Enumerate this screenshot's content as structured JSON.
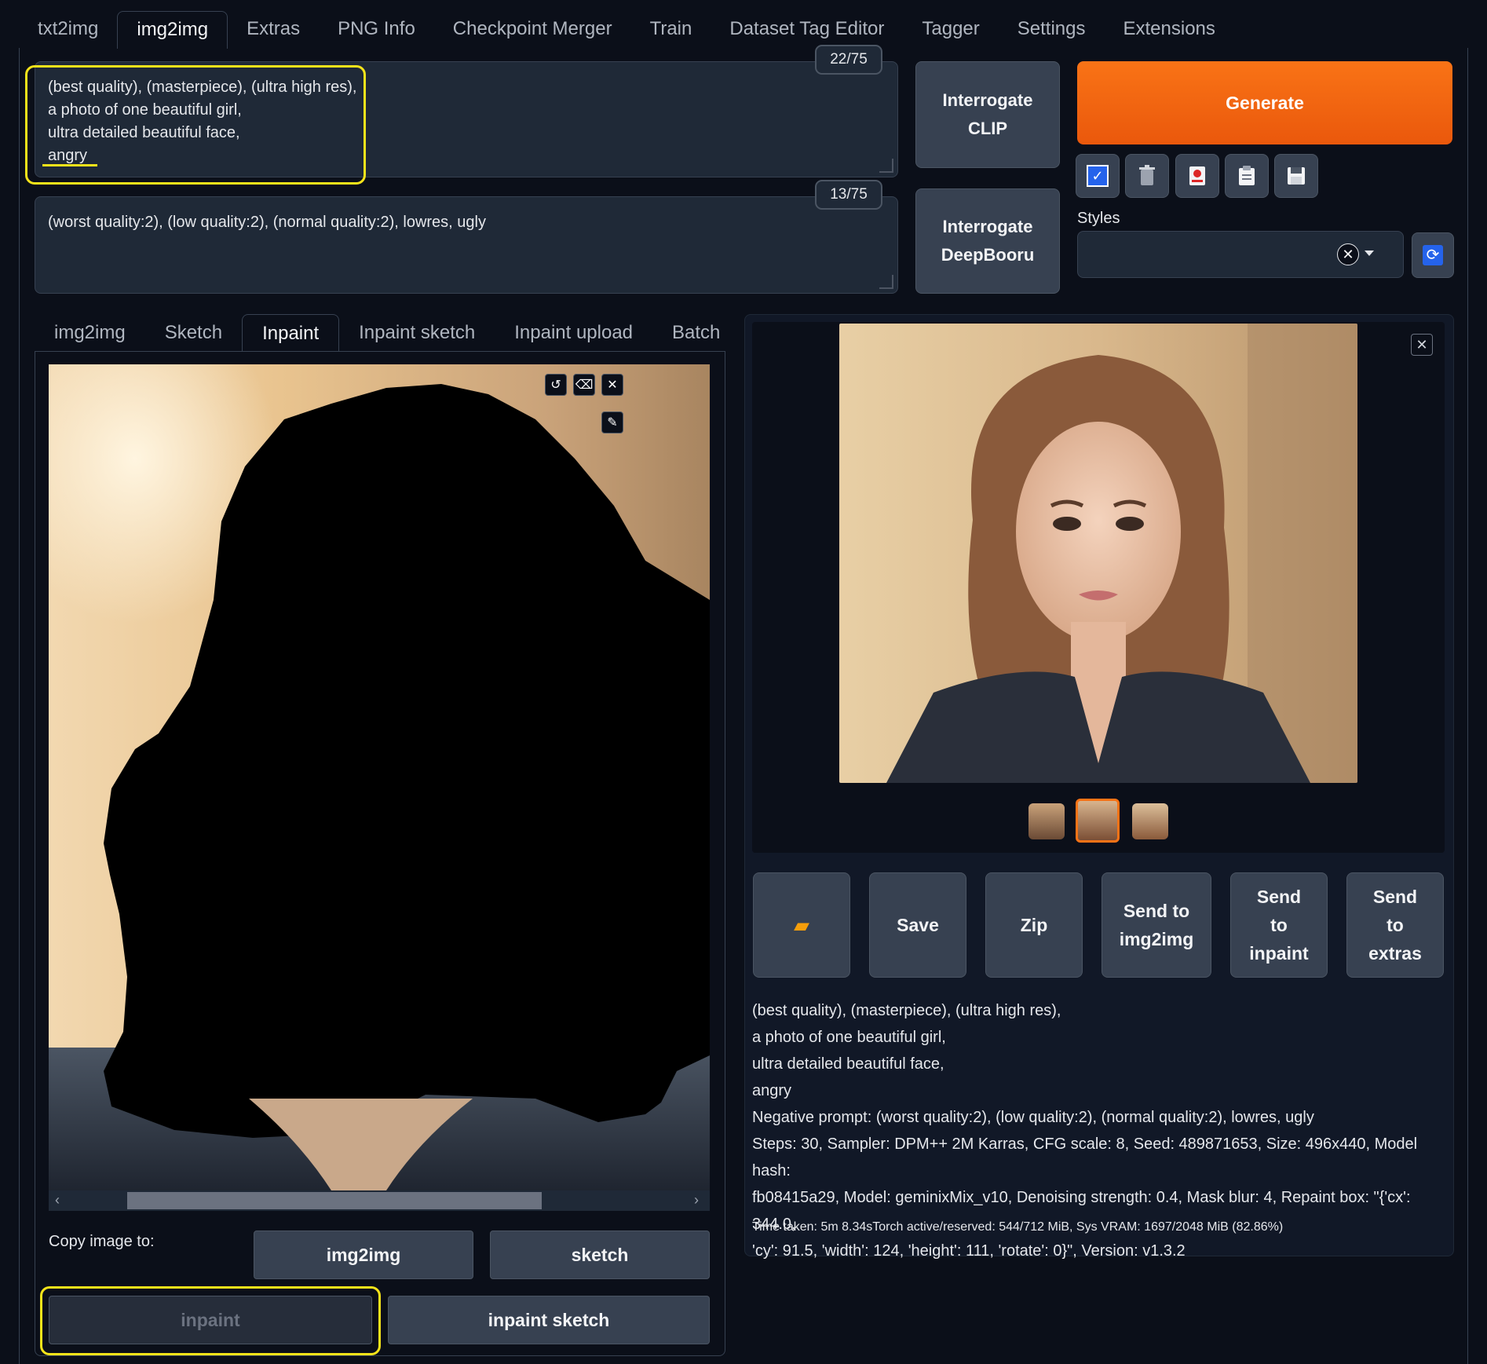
{
  "top_tabs": [
    "txt2img",
    "img2img",
    "Extras",
    "PNG Info",
    "Checkpoint Merger",
    "Train",
    "Dataset Tag Editor",
    "Tagger",
    "Settings",
    "Extensions"
  ],
  "prompt": {
    "lines": [
      "(best quality), (masterpiece), (ultra high res),",
      "a photo of one beautiful girl,",
      "ultra detailed beautiful face,",
      "angry"
    ],
    "token_count": "22/75"
  },
  "negative_prompt": {
    "text": "(worst quality:2), (low quality:2), (normal quality:2), lowres, ugly",
    "token_count": "13/75"
  },
  "interrogate": {
    "clip_label_1": "Interrogate",
    "clip_label_2": "CLIP",
    "deepbooru_label_1": "Interrogate",
    "deepbooru_label_2": "DeepBooru"
  },
  "generate_label": "Generate",
  "tool_buttons": [
    "check-icon",
    "trash-icon",
    "image-icon",
    "clipboard-icon",
    "save-icon"
  ],
  "styles": {
    "label": "Styles",
    "value": ""
  },
  "sub_tabs": [
    "img2img",
    "Sketch",
    "Inpaint",
    "Inpaint sketch",
    "Inpaint upload",
    "Batch"
  ],
  "copy": {
    "label": "Copy image to:",
    "img2img": "img2img",
    "sketch": "sketch",
    "inpaint": "inpaint",
    "inpaint_sketch": "inpaint sketch"
  },
  "output_buttons": {
    "save": "Save",
    "zip": "Zip",
    "send_img2img_1": "Send to",
    "send_img2img_2": "img2img",
    "send_inpaint_1": "Send",
    "send_inpaint_2": "to",
    "send_inpaint_3": "inpaint",
    "send_extras_1": "Send",
    "send_extras_2": "to",
    "send_extras_3": "extras"
  },
  "generation_info": {
    "lines": [
      "(best quality), (masterpiece), (ultra high res),",
      "a photo of one beautiful girl,",
      "ultra detailed beautiful face,",
      "angry",
      "Negative prompt: (worst quality:2), (low quality:2), (normal quality:2), lowres, ugly",
      "Steps: 30, Sampler: DPM++ 2M Karras, CFG scale: 8, Seed: 489871653, Size: 496x440, Model hash:",
      "fb08415a29, Model: geminixMix_v10, Denoising strength: 0.4, Mask blur: 4, Repaint box: \"{'cx': 344.0,",
      "'cy': 91.5, 'width': 124, 'height': 111, 'rotate': 0}\", Version: v1.3.2"
    ],
    "time_taken": "Time taken: 5m 8.34sTorch active/reserved: 544/712 MiB, Sys VRAM: 1697/2048 MiB (82.86%)"
  },
  "colors": {
    "accent": "#f97316",
    "highlight": "#f5e31a",
    "background": "#0b0f19"
  }
}
